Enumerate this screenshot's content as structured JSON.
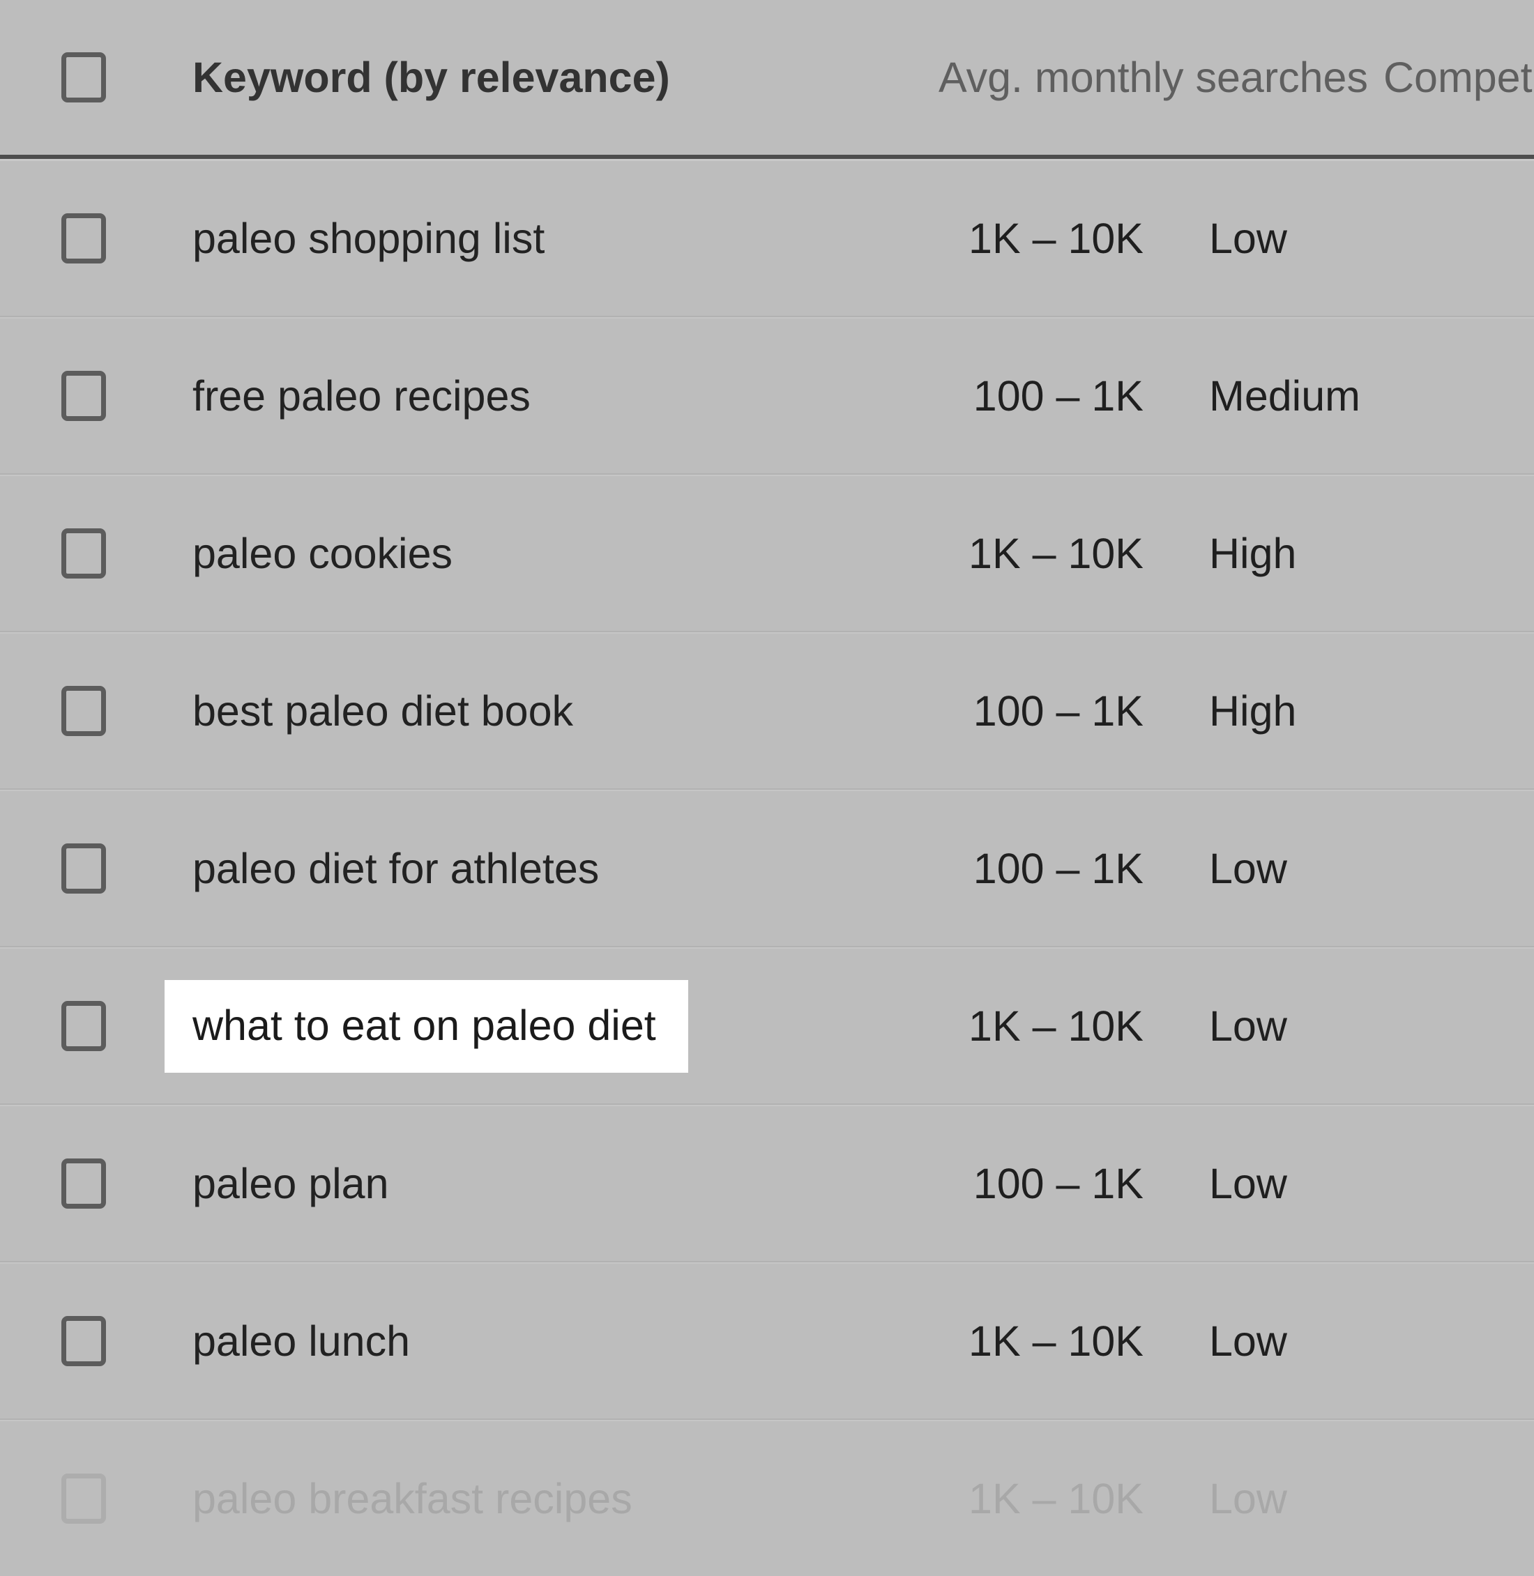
{
  "table": {
    "header": {
      "select_all_checkbox": "select-all",
      "columns": [
        {
          "label": "Keyword (by relevance)",
          "key": "keyword"
        },
        {
          "label": "Avg. monthly searches",
          "key": "volume"
        },
        {
          "label": "Competition",
          "key": "competition"
        }
      ]
    },
    "rows": [
      {
        "keyword": "paleo shopping list",
        "volume": "1K – 10K",
        "competition": "Low",
        "checked": false,
        "highlighted": false,
        "faded": false
      },
      {
        "keyword": "free paleo recipes",
        "volume": "100 – 1K",
        "competition": "Medium",
        "checked": false,
        "highlighted": false,
        "faded": false
      },
      {
        "keyword": "paleo cookies",
        "volume": "1K – 10K",
        "competition": "High",
        "checked": false,
        "highlighted": false,
        "faded": false
      },
      {
        "keyword": "best paleo diet book",
        "volume": "100 – 1K",
        "competition": "High",
        "checked": false,
        "highlighted": false,
        "faded": false
      },
      {
        "keyword": "paleo diet for athletes",
        "volume": "100 – 1K",
        "competition": "Low",
        "checked": false,
        "highlighted": false,
        "faded": false
      },
      {
        "keyword": "what to eat on paleo diet",
        "volume": "1K – 10K",
        "competition": "Low",
        "checked": false,
        "highlighted": true,
        "faded": false
      },
      {
        "keyword": "paleo plan",
        "volume": "100 – 1K",
        "competition": "Low",
        "checked": false,
        "highlighted": false,
        "faded": false
      },
      {
        "keyword": "paleo lunch",
        "volume": "1K – 10K",
        "competition": "Low",
        "checked": false,
        "highlighted": false,
        "faded": false
      },
      {
        "keyword": "paleo breakfast recipes",
        "volume": "1K – 10K",
        "competition": "Low",
        "checked": false,
        "highlighted": false,
        "faded": true
      }
    ]
  },
  "colors": {
    "background": "#bdbdbd",
    "header_divider": "#4e4e4e",
    "row_divider": "#b2b2b2",
    "text_primary": "#222222",
    "text_header_muted": "#5f5f5f",
    "text_header_strong": "#333333",
    "text_faded": "#a8a8a8",
    "highlight_background": "#ffffff",
    "checkbox_border": "#5c5c5c"
  }
}
